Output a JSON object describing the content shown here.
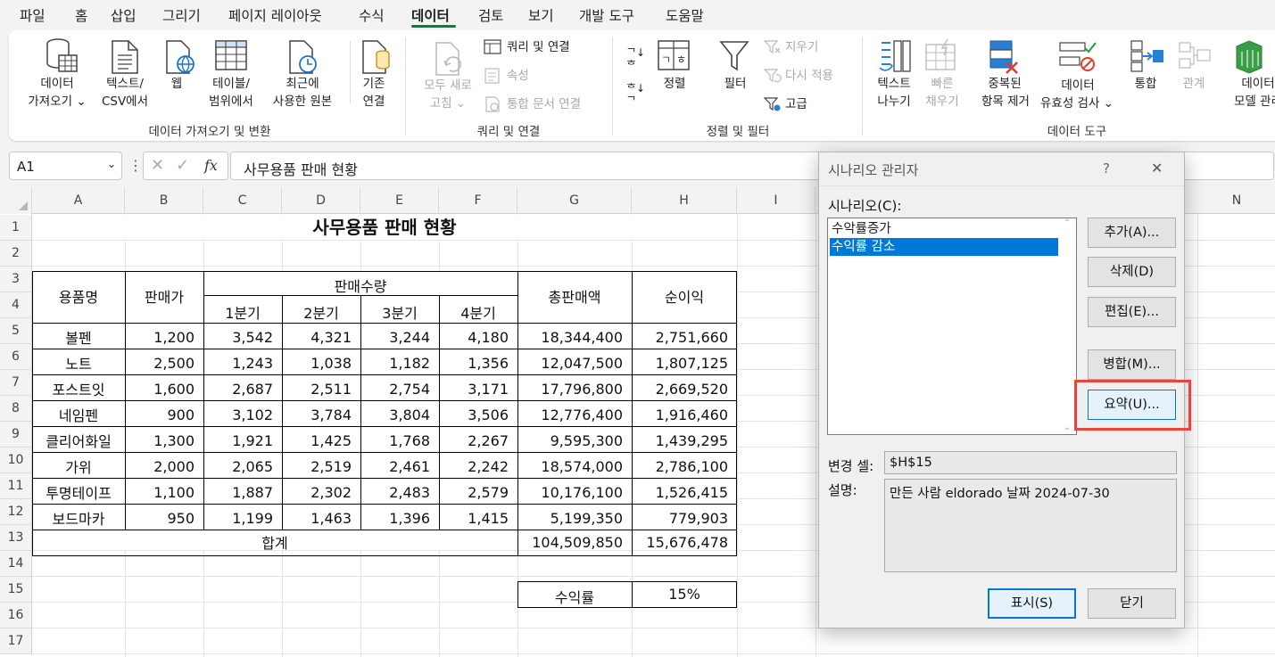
{
  "menu": [
    "파일",
    "홈",
    "삽입",
    "그리기",
    "페이지 레이아웃",
    "수식",
    "데이터",
    "검토",
    "보기",
    "개발 도구",
    "도움말"
  ],
  "active_menu": "데이터",
  "ribbon": {
    "get_data": [
      "데이터",
      "가져오기 ⌄"
    ],
    "text_csv": [
      "텍스트/",
      "CSV에서"
    ],
    "web": "웹",
    "from_table": [
      "테이블/",
      "범위에서"
    ],
    "recent_sources": [
      "최근에",
      "사용한 원본"
    ],
    "existing_conn": [
      "기존",
      "연결"
    ],
    "group_get": "데이터 가져오기 및 변환",
    "refresh_all": [
      "모두 새로",
      "고침 ⌄"
    ],
    "queries_conn": "쿼리 및 연결",
    "properties": "속성",
    "edit_links": "통합 문서 연결",
    "group_queries": "쿼리 및 연결",
    "sort": "정렬",
    "filter": "필터",
    "clear": "지우기",
    "reapply": "다시 적용",
    "advanced": "고급",
    "group_sort": "정렬 및 필터",
    "text_to_columns": [
      "텍스트",
      "나누기"
    ],
    "flash_fill": [
      "빠른",
      "채우기"
    ],
    "remove_dup": [
      "중복된",
      "항목 제거"
    ],
    "data_validation": [
      "데이터",
      "유효성 검사 ⌄"
    ],
    "consolidate": "통합",
    "relationships": "관계",
    "data_model": [
      "데이터",
      "모델 관리"
    ],
    "group_tools": "데이터 도구"
  },
  "formula_bar": {
    "name_box": "A1",
    "fx": "fx",
    "formula": "사무용품 판매 현황"
  },
  "sheet": {
    "columns": [
      "A",
      "B",
      "C",
      "D",
      "E",
      "F",
      "G",
      "H",
      "I",
      "",
      "",
      "",
      "",
      "N"
    ],
    "rows": [
      "1",
      "2",
      "3",
      "4",
      "5",
      "6",
      "7",
      "8",
      "9",
      "10",
      "11",
      "12",
      "13",
      "14",
      "15",
      "16",
      "17"
    ],
    "title": "사무용품 판매 현황",
    "headers": {
      "item": "용품명",
      "price": "판매가",
      "qty": "판매수량",
      "total": "총판매액",
      "profit": "순이익"
    },
    "quarters": [
      "1분기",
      "2분기",
      "3분기",
      "4분기"
    ],
    "data": [
      [
        "볼펜",
        "1,200",
        "3,542",
        "4,321",
        "3,244",
        "4,180",
        "18,344,400",
        "2,751,660"
      ],
      [
        "노트",
        "2,500",
        "1,243",
        "1,038",
        "1,182",
        "1,356",
        "12,047,500",
        "1,807,125"
      ],
      [
        "포스트잇",
        "1,600",
        "2,687",
        "2,511",
        "2,754",
        "3,171",
        "17,796,800",
        "2,669,520"
      ],
      [
        "네임펜",
        "900",
        "3,102",
        "3,784",
        "3,804",
        "3,506",
        "12,776,400",
        "1,916,460"
      ],
      [
        "클리어화일",
        "1,300",
        "1,921",
        "1,425",
        "1,768",
        "2,267",
        "9,595,300",
        "1,439,295"
      ],
      [
        "가위",
        "2,000",
        "2,065",
        "2,519",
        "2,461",
        "2,242",
        "18,574,000",
        "2,786,100"
      ],
      [
        "투명테이프",
        "1,100",
        "1,887",
        "2,302",
        "2,483",
        "2,579",
        "10,176,100",
        "1,526,415"
      ],
      [
        "보드마카",
        "950",
        "1,199",
        "1,463",
        "1,396",
        "1,415",
        "5,199,350",
        "779,903"
      ]
    ],
    "sum_label": "합계",
    "sum_total": "104,509,850",
    "sum_profit": "15,676,478",
    "rate_label": "수익률",
    "rate_value": "15%"
  },
  "dialog": {
    "title": "시나리오 관리자",
    "help": "?",
    "close": "✕",
    "scenario_label": "시나리오(C):",
    "scenarios": [
      "수악률증가",
      "수익률 감소"
    ],
    "selected_index": 1,
    "buttons": {
      "add": "추가(A)...",
      "delete": "삭제(D)",
      "edit": "편집(E)...",
      "merge": "병합(M)...",
      "summary": "요약(U)...",
      "show": "표시(S)",
      "close": "닫기"
    },
    "changing_cells_label": "변경 셀:",
    "changing_cells": "$H$15",
    "description_label": "설명:",
    "description": "만든 사람 eldorado 날짜 2024-07-30",
    "highlight_color": "#e8453c",
    "selection_color": "#0078d7"
  }
}
